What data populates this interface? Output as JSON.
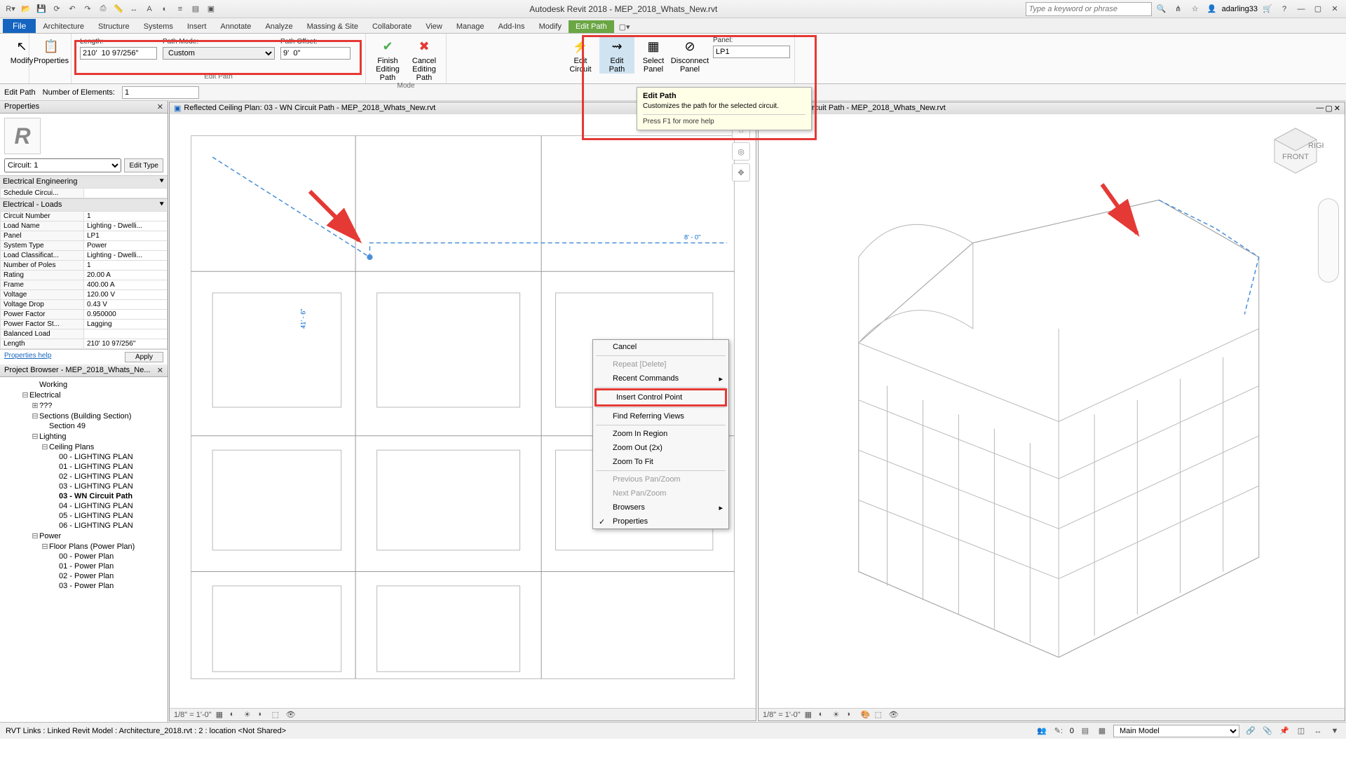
{
  "title": "Autodesk Revit 2018 -   MEP_2018_Whats_New.rvt",
  "search_placeholder": "Type a keyword or phrase",
  "user": "adarling33",
  "tabs": {
    "file": "File",
    "arch": "Architecture",
    "struct": "Structure",
    "sys": "Systems",
    "insert": "Insert",
    "annotate": "Annotate",
    "analyze": "Analyze",
    "mass": "Massing & Site",
    "collab": "Collaborate",
    "view": "View",
    "manage": "Manage",
    "addins": "Add-Ins",
    "modify": "Modify",
    "editpath": "Edit Path"
  },
  "ribbon": {
    "modify": "Modify",
    "properties": "Properties",
    "length_label": "Length:",
    "length_val": "210'  10 97/256\"",
    "mode_label": "Path Mode:",
    "mode_val": "Custom",
    "offset_label": "Path Offset:",
    "offset_val": "9'  0\"",
    "finish": "Finish\nEditing Path",
    "cancel": "Cancel\nEditing Path",
    "mode_group": "Mode",
    "editcircuit": "Edit\nCircuit",
    "editpath": "Edit\nPath",
    "selectpanel": "Select\nPanel",
    "disconnect": "Disconnect\nPanel",
    "panel_label": "Panel:",
    "panel_val": "LP1",
    "editpath_group_label": "Edit Path"
  },
  "secbar": {
    "editpath": "Edit Path",
    "num_label": "Number of Elements:",
    "num_val": "1"
  },
  "props": {
    "title": "Properties",
    "type": "Circuit: 1",
    "edit_type": "Edit Type",
    "cat1": "Electrical Engineering",
    "sched": "Schedule Circui...",
    "cat2": "Electrical - Loads",
    "rows": [
      [
        "Circuit Number",
        "1"
      ],
      [
        "Load Name",
        "Lighting - Dwelli..."
      ],
      [
        "Panel",
        "LP1"
      ],
      [
        "System Type",
        "Power"
      ],
      [
        "Load Classificat...",
        "Lighting - Dwelli..."
      ],
      [
        "Number of Poles",
        "1"
      ],
      [
        "Rating",
        "20.00 A"
      ],
      [
        "Frame",
        "400.00 A"
      ],
      [
        "Voltage",
        "120.00 V"
      ],
      [
        "Voltage Drop",
        "0.43 V"
      ],
      [
        "Power Factor",
        "0.950000"
      ],
      [
        "Power Factor St...",
        "Lagging"
      ],
      [
        "Balanced Load",
        ""
      ],
      [
        "Length",
        "210'  10 97/256\""
      ]
    ],
    "help": "Properties help",
    "apply": "Apply"
  },
  "browser": {
    "title": "Project Browser - MEP_2018_Whats_Ne...",
    "items": [
      {
        "txt": "Working",
        "ind": 3
      },
      {
        "txt": "Electrical",
        "ind": 2,
        "exp": "-"
      },
      {
        "txt": "???",
        "ind": 3,
        "exp": "+"
      },
      {
        "txt": "Sections (Building Section)",
        "ind": 3,
        "exp": "-"
      },
      {
        "txt": "Section 49",
        "ind": 4
      },
      {
        "txt": "Lighting",
        "ind": 3,
        "exp": "-"
      },
      {
        "txt": "Ceiling Plans",
        "ind": 4,
        "exp": "-"
      },
      {
        "txt": "00 - LIGHTING PLAN",
        "ind": 5
      },
      {
        "txt": "01 - LIGHTING PLAN",
        "ind": 5
      },
      {
        "txt": "02 - LIGHTING PLAN",
        "ind": 5
      },
      {
        "txt": "03 - LIGHTING PLAN",
        "ind": 5
      },
      {
        "txt": "03 - WN Circuit Path",
        "ind": 5,
        "bold": true
      },
      {
        "txt": "04 - LIGHTING PLAN",
        "ind": 5
      },
      {
        "txt": "05 - LIGHTING PLAN",
        "ind": 5
      },
      {
        "txt": "06 - LIGHTING PLAN",
        "ind": 5
      },
      {
        "txt": "Power",
        "ind": 3,
        "exp": "-"
      },
      {
        "txt": "Floor Plans (Power Plan)",
        "ind": 4,
        "exp": "-"
      },
      {
        "txt": "00 - Power Plan",
        "ind": 5
      },
      {
        "txt": "01 - Power Plan",
        "ind": 5
      },
      {
        "txt": "02 - Power Plan",
        "ind": 5
      },
      {
        "txt": "03 - Power Plan",
        "ind": 5
      }
    ]
  },
  "view1": {
    "title": "Reflected Ceiling Plan: 03 - WN Circuit Path  -  MEP_2018_Whats_New.rvt",
    "scale": "1/8\" = 1'-0\"",
    "dim1": "41' - 6\"",
    "dim2": "8' - 0\""
  },
  "view2": {
    "title": "3D - WN Circuit Path  -  MEP_2018_Whats_New.rvt",
    "scale": "1/8\" = 1'-0\""
  },
  "ctx": {
    "cancel": "Cancel",
    "repeat": "Repeat [Delete]",
    "recent": "Recent Commands",
    "insert": "Insert Control Point",
    "find": "Find Referring Views",
    "zin": "Zoom In Region",
    "zout": "Zoom Out (2x)",
    "zfit": "Zoom To Fit",
    "prevpz": "Previous Pan/Zoom",
    "nextpz": "Next Pan/Zoom",
    "browsers": "Browsers",
    "props": "Properties"
  },
  "tooltip": {
    "title": "Edit Path",
    "desc": "Customizes the path for the selected circuit.",
    "help": "Press F1 for more help"
  },
  "status": {
    "left": "RVT Links : Linked Revit Model : Architecture_2018.rvt : 2 : location <Not Shared>",
    "sel0": "0",
    "main_model": "Main Model"
  }
}
